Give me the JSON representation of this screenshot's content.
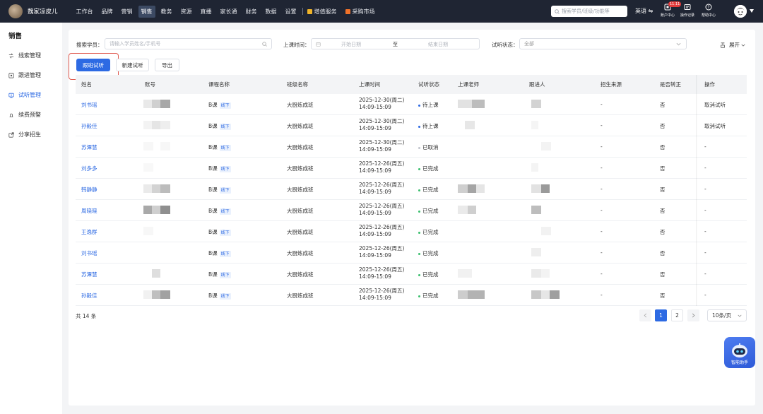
{
  "topbar": {
    "school_name": "魏家凉皮儿",
    "nav": [
      "工作台",
      "品牌",
      "营销",
      "销售",
      "教务",
      "资源",
      "直播",
      "家长通",
      "财务",
      "数据",
      "设置"
    ],
    "active_nav": "销售",
    "extra_nav": [
      {
        "label": "增值服务",
        "icon": "grid-icon",
        "color": "#f0b429"
      },
      {
        "label": "采购市场",
        "icon": "store-icon",
        "color": "#f07229"
      }
    ],
    "search_placeholder": "搜索学员/班级/功能等",
    "language": "英语",
    "tools": [
      {
        "label": "账户中心",
        "icon": "account-icon",
        "badge": "11.11"
      },
      {
        "label": "操作记录",
        "icon": "record-icon"
      },
      {
        "label": "帮助中心",
        "icon": "help-icon"
      }
    ]
  },
  "sidebar": {
    "title": "销售",
    "items": [
      {
        "label": "线索管理",
        "icon": "clue-icon"
      },
      {
        "label": "跟进管理",
        "icon": "follow-icon"
      },
      {
        "label": "试听管理",
        "icon": "trial-icon",
        "active": true
      },
      {
        "label": "续费预警",
        "icon": "renew-icon"
      },
      {
        "label": "分享招生",
        "icon": "share-icon"
      }
    ]
  },
  "filters": {
    "student_label": "搜索学员：",
    "student_placeholder": "请输入学员姓名/手机号",
    "time_label": "上课时间：",
    "start_placeholder": "开始日期",
    "range_sep": "至",
    "end_placeholder": "结束日期",
    "status_label": "试听状态：",
    "status_value": "全部",
    "expand_label": "展开"
  },
  "actions": {
    "follow_trial": "跟班试听",
    "new_trial": "新建试听",
    "export": "导出"
  },
  "table": {
    "columns": [
      "姓名",
      "账号",
      "课程名称",
      "班级名称",
      "上课时间",
      "试听状态",
      "上课老师",
      "跟进人",
      "招生来源",
      "是否转正",
      "操作"
    ],
    "rows": [
      {
        "name": "刘书瑶",
        "course": "B课",
        "tag": "线下",
        "class": "大厨炼成班",
        "date": "2025-12-30(周二)",
        "time": "14:09-15:09",
        "status": "待上课",
        "source": "-",
        "converted": "否",
        "op": "取消试听"
      },
      {
        "name": "孙毅佳",
        "course": "B课",
        "tag": "线下",
        "class": "大厨炼成班",
        "date": "2025-12-30(周二)",
        "time": "14:09-15:09",
        "status": "待上课",
        "source": "-",
        "converted": "否",
        "op": "取消试听"
      },
      {
        "name": "苏潭慧",
        "course": "B课",
        "tag": "线下",
        "class": "大厨炼成班",
        "date": "2025-12-30(周二)",
        "time": "14:09-15:09",
        "status": "已取消",
        "source": "-",
        "converted": "否",
        "op": "-"
      },
      {
        "name": "刘多多",
        "course": "B课",
        "tag": "线下",
        "class": "大厨炼成班",
        "date": "2025-12-26(周五)",
        "time": "14:09-15:09",
        "status": "已完成",
        "source": "-",
        "converted": "否",
        "op": "-"
      },
      {
        "name": "韩静静",
        "course": "B课",
        "tag": "线下",
        "class": "大厨炼成班",
        "date": "2025-12-26(周五)",
        "time": "14:09-15:09",
        "status": "已完成",
        "source": "-",
        "converted": "否",
        "op": "-"
      },
      {
        "name": "周晓晓",
        "course": "B课",
        "tag": "线下",
        "class": "大厨炼成班",
        "date": "2025-12-26(周五)",
        "time": "14:09-15:09",
        "status": "已完成",
        "source": "-",
        "converted": "否",
        "op": "-"
      },
      {
        "name": "王逸群",
        "course": "B课",
        "tag": "线下",
        "class": "大厨炼成班",
        "date": "2025-12-26(周五)",
        "time": "14:09-15:09",
        "status": "已完成",
        "source": "-",
        "converted": "否",
        "op": "-"
      },
      {
        "name": "刘书瑶",
        "course": "B课",
        "tag": "线下",
        "class": "大厨炼成班",
        "date": "2025-12-26(周五)",
        "time": "14:09-15:09",
        "status": "已完成",
        "source": "-",
        "converted": "否",
        "op": "-"
      },
      {
        "name": "苏潭慧",
        "course": "B课",
        "tag": "线下",
        "class": "大厨炼成班",
        "date": "2025-12-26(周五)",
        "time": "14:09-15:09",
        "status": "已完成",
        "source": "-",
        "converted": "否",
        "op": "-"
      },
      {
        "name": "孙毅佳",
        "course": "B课",
        "tag": "线下",
        "class": "大厨炼成班",
        "date": "2025-12-26(周五)",
        "time": "14:09-15:09",
        "status": "已完成",
        "source": "-",
        "converted": "否",
        "op": "-"
      }
    ]
  },
  "status_colors": {
    "待上课": "#2d6ae3",
    "已取消": "#c0c4cc",
    "已完成": "#3cbf6e"
  },
  "pagination": {
    "total": "共 14 条",
    "pages": [
      "1",
      "2"
    ],
    "current": "1",
    "page_size": "10条/页"
  },
  "assistant": {
    "label": "智能助手"
  },
  "colors": {
    "primary": "#2d6ae3",
    "topbar": "#1f2533",
    "highlight": "#e05a4f"
  }
}
